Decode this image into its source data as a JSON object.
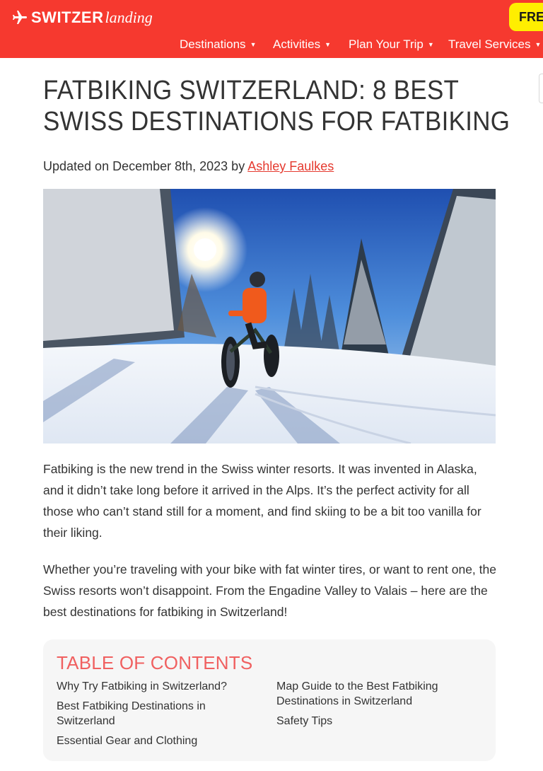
{
  "header": {
    "logo_bold": "SWITZER",
    "logo_script": "landing",
    "cta_label": "FRE",
    "nav": [
      {
        "label": "Destinations"
      },
      {
        "label": "Activities"
      },
      {
        "label": "Plan Your Trip"
      },
      {
        "label": "Travel Services"
      }
    ]
  },
  "article": {
    "title": "FATBIKING SWITZERLAND: 8 BEST SWISS DESTINATIONS FOR FATBIKING",
    "byline_prefix": "Updated on December 8th, 2023 by",
    "author": "Ashley Faulkes",
    "paragraphs": [
      "Fatbiking is the new trend in the Swiss winter resorts. It was invented in Alaska, and it didn’t take long before it arrived in the Alps. It’s the perfect activity for all those who can’t stand still for a moment, and find skiing to be a bit too vanilla for their liking.",
      "Whether you’re traveling with your bike with fat winter tires, or want to rent one, the Swiss resorts won’t disappoint. From the Engadine Valley to Valais – here are the best destinations for fatbiking in Switzerland!"
    ]
  },
  "toc": {
    "title": "TABLE OF CONTENTS",
    "items": [
      "Why Try Fatbiking in Switzerland?",
      "Best Fatbiking Destinations in Switzerland",
      "Essential Gear and Clothing",
      "Map Guide to the Best Fatbiking Destinations in Switzerland",
      "Safety Tips"
    ]
  },
  "colors": {
    "brand_red": "#f6392f",
    "cta_yellow": "#ffee00",
    "toc_title": "#f06060",
    "link": "#e53a2f"
  }
}
